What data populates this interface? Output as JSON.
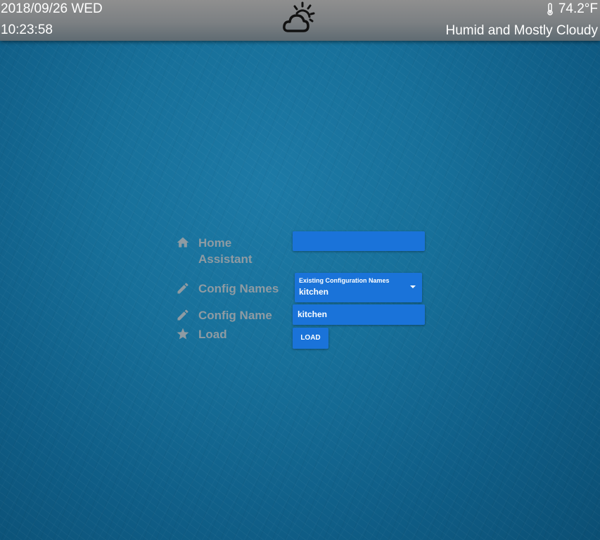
{
  "header": {
    "date": "2018/09/26 WED",
    "time": "10:23:58",
    "weather_icon": "partly-cloudy-day-icon",
    "temperature": "74.2°F",
    "condition": "Humid and Mostly Cloudy"
  },
  "form": {
    "rows": [
      {
        "icon": "home-icon",
        "label": "Home Assistant"
      },
      {
        "icon": "pencil-icon",
        "label": "Config Names"
      },
      {
        "icon": "pencil-icon",
        "label": "Config Name"
      },
      {
        "icon": "star-icon",
        "label": "Load"
      }
    ],
    "home_assistant_value": "",
    "config_select": {
      "label": "Existing Configuration Names",
      "value": "kitchen"
    },
    "config_name_value": "kitchen",
    "load_button": "LOAD"
  },
  "colors": {
    "background": "#17709a",
    "field": "#1a73d9",
    "label": "#8e9ba3",
    "header": "#7c8083"
  }
}
